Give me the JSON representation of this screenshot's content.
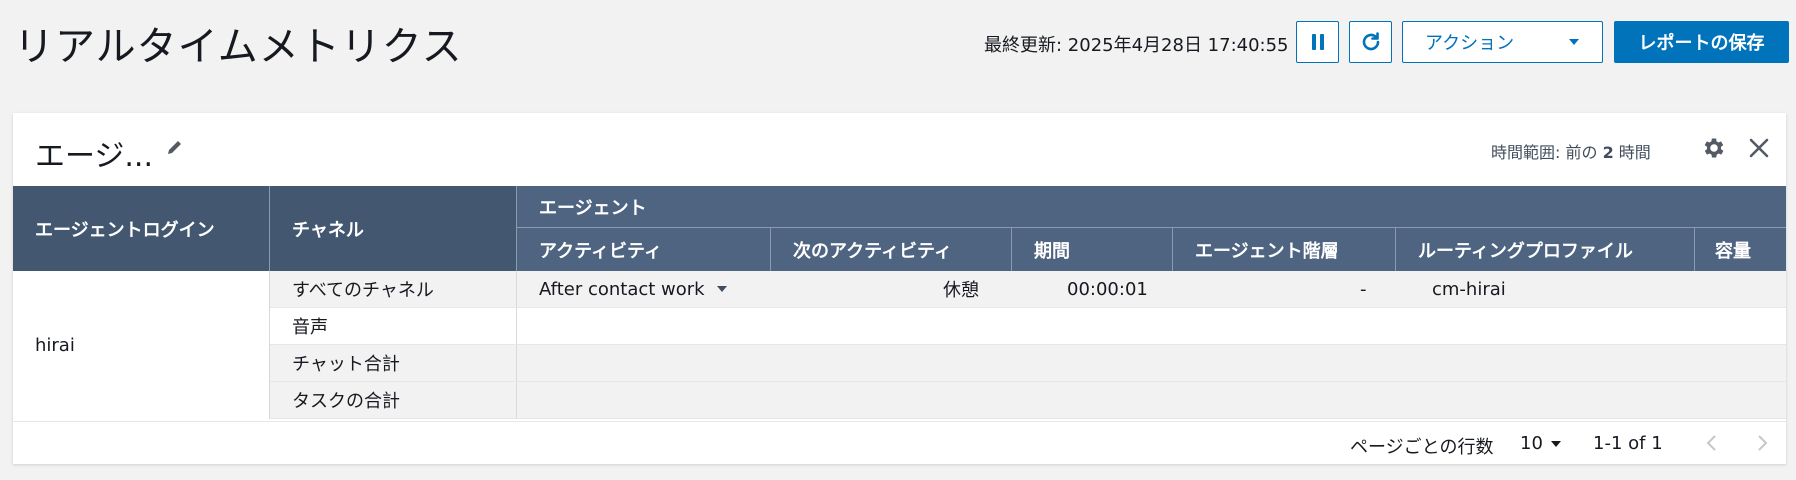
{
  "header": {
    "title": "リアルタイムメトリクス",
    "last_updated": "最終更新: 2025年4月28日 17:40:55",
    "actions_label": "アクション",
    "save_label": "レポートの保存"
  },
  "panel": {
    "title": "エージ...",
    "time_range_prefix": "時間範囲: 前の ",
    "time_range_value": "2",
    "time_range_suffix": " 時間"
  },
  "table": {
    "columns": {
      "agent_login": "エージェントログイン",
      "channel": "チャネル",
      "agent_group": "エージェント",
      "activity": "アクティビティ",
      "next_activity": "次のアクティビティ",
      "duration": "期間",
      "hierarchy": "エージェント階層",
      "routing_profile": "ルーティングプロファイル",
      "capacity": "容量"
    },
    "agent": "hirai",
    "rows": [
      {
        "channel": "すべてのチャネル",
        "activity": "After contact work",
        "next_activity": "休憩",
        "duration": "00:00:01",
        "hierarchy": "-",
        "routing_profile": "cm-hirai",
        "capacity": ""
      },
      {
        "channel": "音声"
      },
      {
        "channel": "チャット合計"
      },
      {
        "channel": "タスクの合計"
      }
    ]
  },
  "footer": {
    "rows_per_page_label": "ページごとの行数",
    "rows_per_page_value": "10",
    "range": "1-1 of 1"
  },
  "colors": {
    "accent": "#0073bb",
    "header_bg": "#4f6480",
    "header_dark": "#435870"
  }
}
